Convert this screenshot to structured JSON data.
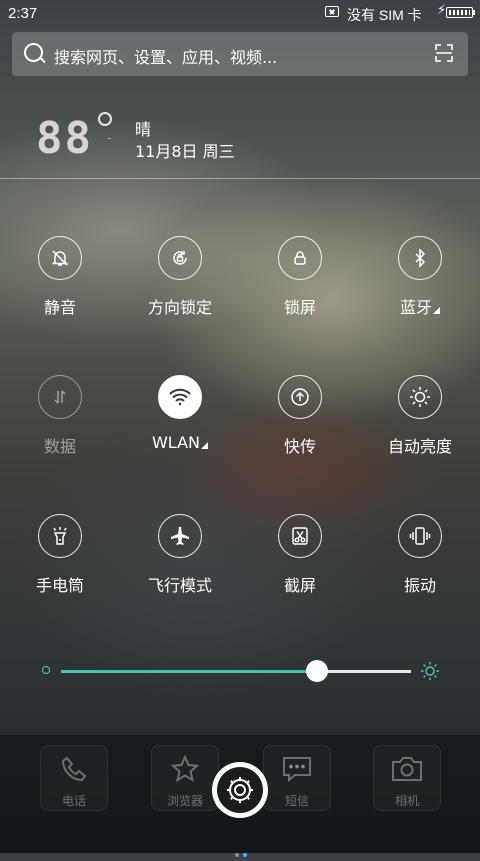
{
  "status_bar": {
    "time": "2:37",
    "carrier": "没有 SIM 卡"
  },
  "search": {
    "placeholder": "搜索网页、设置、应用、视频..."
  },
  "weather": {
    "temperature_display": "88",
    "condition": "晴",
    "date": "11月8日 周三"
  },
  "toggles": [
    {
      "label": "静音",
      "icon": "bell-off-icon",
      "state": "off"
    },
    {
      "label": "方向锁定",
      "icon": "rotation-lock-icon",
      "state": "off"
    },
    {
      "label": "锁屏",
      "icon": "lock-icon",
      "state": "off"
    },
    {
      "label": "蓝牙",
      "icon": "bluetooth-icon",
      "state": "off",
      "has_menu": true
    },
    {
      "label": "数据",
      "icon": "mobile-data-icon",
      "state": "disabled"
    },
    {
      "label": "WLAN",
      "icon": "wifi-icon",
      "state": "on",
      "has_menu": true
    },
    {
      "label": "快传",
      "icon": "quick-transfer-icon",
      "state": "off"
    },
    {
      "label": "自动亮度",
      "icon": "auto-brightness-icon",
      "state": "off"
    },
    {
      "label": "手电筒",
      "icon": "flashlight-icon",
      "state": "off"
    },
    {
      "label": "飞行模式",
      "icon": "airplane-icon",
      "state": "off"
    },
    {
      "label": "截屏",
      "icon": "screenshot-icon",
      "state": "off"
    },
    {
      "label": "振动",
      "icon": "vibrate-icon",
      "state": "off"
    }
  ],
  "brightness": {
    "level": 0.73
  },
  "dock": {
    "apps": [
      {
        "label": "电话",
        "icon": "phone-icon"
      },
      {
        "label": "浏览器",
        "icon": "star-icon"
      },
      {
        "label": "短信",
        "icon": "message-icon"
      },
      {
        "label": "相机",
        "icon": "camera-icon"
      }
    ],
    "page_indicator": {
      "pages": 2,
      "current": 2
    }
  },
  "colors": {
    "accent": "#49c2ae",
    "page_dot_active": "#3fb3ff"
  }
}
